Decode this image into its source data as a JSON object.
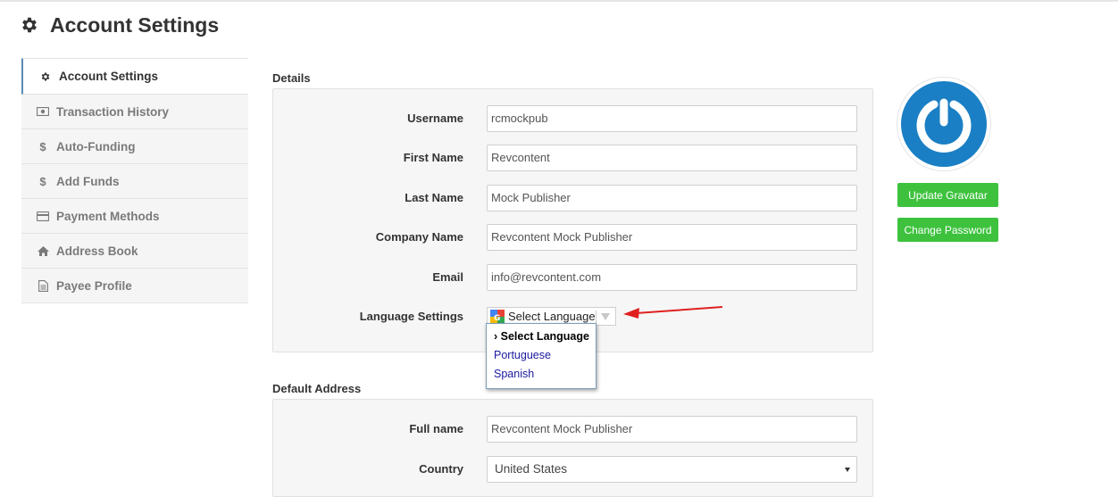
{
  "page": {
    "title": "Account Settings"
  },
  "sidebar": {
    "items": [
      {
        "label": "Account Settings",
        "icon": "gear-icon",
        "active": true
      },
      {
        "label": "Transaction History",
        "icon": "money-icon"
      },
      {
        "label": "Auto-Funding",
        "icon": "dollar-icon"
      },
      {
        "label": "Add Funds",
        "icon": "dollar-icon"
      },
      {
        "label": "Payment Methods",
        "icon": "credit-card-icon"
      },
      {
        "label": "Address Book",
        "icon": "home-icon"
      },
      {
        "label": "Payee Profile",
        "icon": "document-icon"
      }
    ]
  },
  "details": {
    "section_label": "Details",
    "username": {
      "label": "Username",
      "value": "rcmockpub"
    },
    "first_name": {
      "label": "First Name",
      "value": "Revcontent"
    },
    "last_name": {
      "label": "Last Name",
      "value": "Mock Publisher"
    },
    "company_name": {
      "label": "Company Name",
      "value": "Revcontent Mock Publisher"
    },
    "email": {
      "label": "Email",
      "value": "info@revcontent.com"
    },
    "language": {
      "label": "Language Settings",
      "selected": "Select Language",
      "options": [
        "› Select Language",
        "Portuguese",
        "Spanish"
      ]
    }
  },
  "default_address": {
    "section_label": "Default Address",
    "full_name": {
      "label": "Full name",
      "value": "Revcontent Mock Publisher"
    },
    "country": {
      "label": "Country",
      "value": "United States"
    }
  },
  "profile": {
    "update_gravatar_label": "Update Gravatar",
    "change_password_label": "Change Password"
  },
  "colors": {
    "accent_green": "#3ec23e",
    "gravatar_blue": "#1a7fc4",
    "arrow_red": "#e02020"
  }
}
